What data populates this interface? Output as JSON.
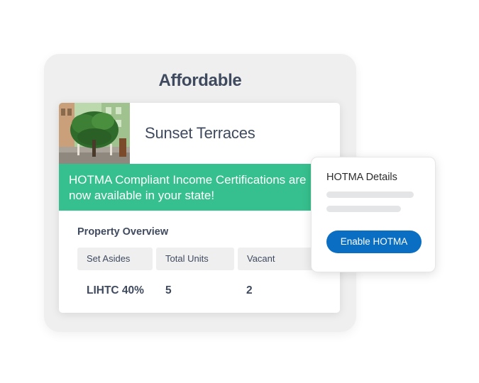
{
  "outer": {
    "title": "Affordable"
  },
  "property": {
    "name": "Sunset Terraces",
    "photo_icon": "building-photo"
  },
  "banner": {
    "text": "HOTMA Compliant Income Certifications are now available in your state!",
    "color": "#37c08f"
  },
  "overview": {
    "title": "Property Overview",
    "columns": [
      "Set Asides",
      "Total Units",
      "Vacant"
    ],
    "row": [
      "LIHTC 40%",
      "5",
      "2"
    ]
  },
  "popover": {
    "title": "HOTMA Details",
    "button_label": "Enable HOTMA",
    "button_color": "#0a6fc2"
  }
}
